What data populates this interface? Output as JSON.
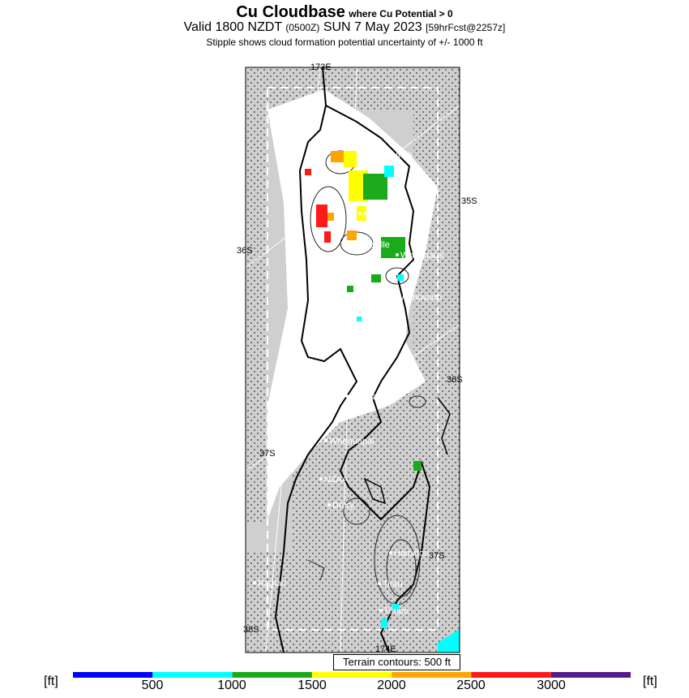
{
  "title": {
    "main": "Cu Cloudbase",
    "condition": "where Cu Potential > 0",
    "valid_prefix": "Valid 1800 NZDT",
    "valid_utc": "(0500Z)",
    "valid_date": "SUN 7 May 2023",
    "forecast": "[59hrFcst@2257z]",
    "subtitle": "Stipple shows cloud formation potential uncertainty of +/- 1000 ft"
  },
  "map": {
    "lon_labels": [
      "173E",
      "174E"
    ],
    "lat_labels": [
      "35S",
      "36S",
      "36S",
      "37S",
      "37S",
      "38S"
    ],
    "places": [
      "Kaitaia",
      "Kaikohe",
      "Whangarei",
      "Rocket",
      "Dargaville",
      "Warkworth",
      "Auckland",
      "Whenuapai",
      "NZAA",
      "Drury",
      "Hamilton",
      "Raglan",
      "Tirau",
      "Taupo"
    ],
    "terrain_note": "Terrain contours: 500 ft"
  },
  "colorbar": {
    "unit": "[ft]",
    "ticks": [
      "500",
      "1000",
      "1500",
      "2000",
      "2500",
      "3000"
    ],
    "colors": [
      "#0000ff",
      "#00ffff",
      "#1aaa1a",
      "#ffff00",
      "#ffa500",
      "#ff1a1a",
      "#551a8b"
    ]
  }
}
